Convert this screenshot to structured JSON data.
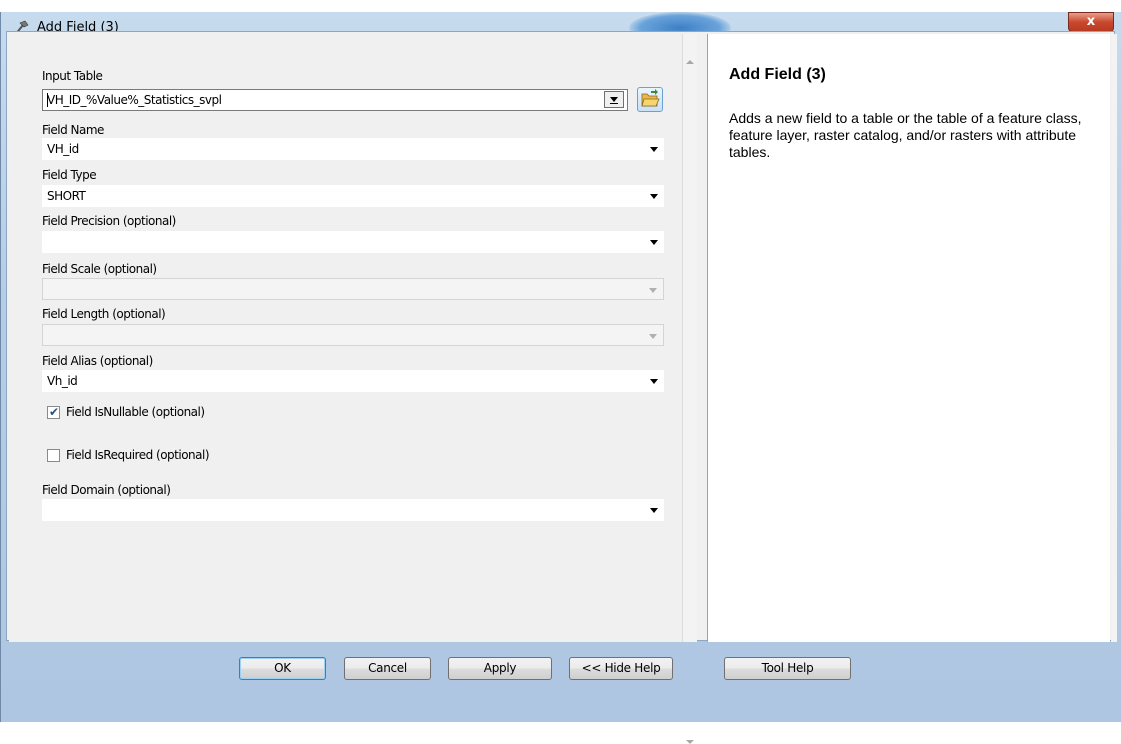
{
  "window": {
    "title": "Add Field (3)",
    "close_glyph": "x"
  },
  "form": {
    "input_table": {
      "label": "Input Table",
      "value": "VH_ID_%Value%_Statistics_svpl"
    },
    "field_name": {
      "label": "Field Name",
      "value": "VH_id"
    },
    "field_type": {
      "label": "Field Type",
      "value": "SHORT"
    },
    "field_precision": {
      "label": "Field Precision (optional)",
      "value": ""
    },
    "field_scale": {
      "label": "Field Scale (optional)",
      "value": ""
    },
    "field_length": {
      "label": "Field Length (optional)",
      "value": ""
    },
    "field_alias": {
      "label": "Field Alias (optional)",
      "value": "Vh_id"
    },
    "is_nullable": {
      "label": "Field IsNullable (optional)",
      "checked": true
    },
    "is_required": {
      "label": "Field IsRequired (optional)",
      "checked": false
    },
    "field_domain": {
      "label": "Field Domain (optional)",
      "value": ""
    }
  },
  "help": {
    "title": "Add Field (3)",
    "body": "Adds a new field to a table or the table of a feature class, feature layer, raster catalog, and/or rasters with attribute tables."
  },
  "buttons": {
    "ok": "OK",
    "cancel": "Cancel",
    "apply": "Apply",
    "hide_help": "<< Hide Help",
    "tool_help": "Tool Help"
  },
  "icons": {
    "app": "hammer-icon",
    "browse": "open-folder-icon",
    "close": "close-icon",
    "check": "checkmark-icon"
  },
  "colors": {
    "title_bar": "#c7dbee",
    "close_button": "#c9492f",
    "panel": "#f0f0f0"
  }
}
